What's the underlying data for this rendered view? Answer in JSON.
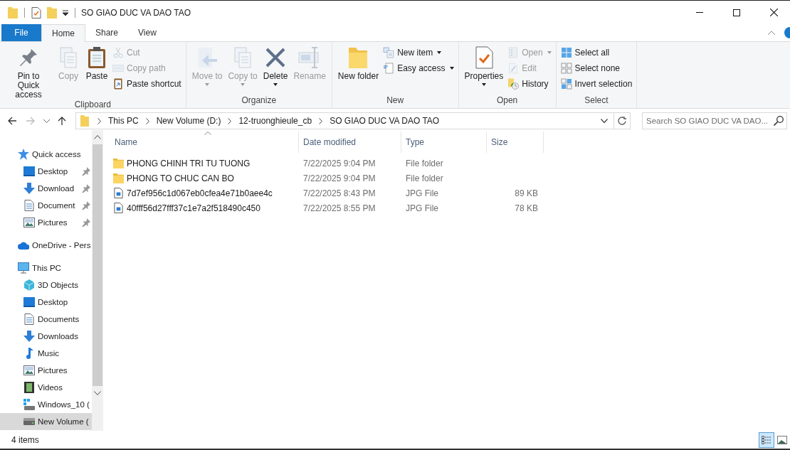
{
  "window": {
    "title": "SO GIAO DUC VA DAO TAO"
  },
  "tabs": [
    {
      "label": "File",
      "kind": "file",
      "selected": false
    },
    {
      "label": "Home",
      "kind": "tab",
      "selected": true
    },
    {
      "label": "Share",
      "kind": "tab",
      "selected": false
    },
    {
      "label": "View",
      "kind": "tab",
      "selected": false
    }
  ],
  "ribbon": [
    {
      "label": "Clipboard",
      "buttons": [
        {
          "kind": "pin",
          "label": "Pin to Quick access",
          "disabled": false,
          "dropdown": false
        },
        {
          "kind": "copy",
          "label": "Copy",
          "disabled": true,
          "dropdown": false
        },
        {
          "kind": "paste",
          "label": "Paste",
          "disabled": false,
          "dropdown": false
        }
      ],
      "small_buttons": [
        {
          "kind": "cut",
          "label": "Cut",
          "disabled": true,
          "dropdown": false
        },
        {
          "kind": "path",
          "label": "Copy path",
          "disabled": true,
          "dropdown": false
        },
        {
          "kind": "shortcut",
          "label": "Paste shortcut",
          "disabled": false,
          "dropdown": false
        }
      ]
    },
    {
      "label": "Organize",
      "buttons": [
        {
          "kind": "move",
          "label": "Move to",
          "disabled": true,
          "dropdown": true
        },
        {
          "kind": "copyto",
          "label": "Copy to",
          "disabled": true,
          "dropdown": true
        },
        {
          "kind": "delete",
          "label": "Delete",
          "disabled": false,
          "dropdown": true
        },
        {
          "kind": "rename",
          "label": "Rename",
          "disabled": true,
          "dropdown": false
        }
      ]
    },
    {
      "label": "New",
      "buttons": [
        {
          "kind": "folder",
          "label": "New folder",
          "disabled": false,
          "dropdown": false
        }
      ],
      "small_buttons": [
        {
          "kind": "newitem",
          "label": "New item",
          "disabled": false,
          "dropdown": true
        },
        {
          "kind": "easy",
          "label": "Easy access",
          "disabled": false,
          "dropdown": true
        }
      ]
    },
    {
      "label": "Open",
      "buttons": [
        {
          "kind": "properties",
          "label": "Properties",
          "disabled": false,
          "dropdown": true
        }
      ],
      "small_buttons": [
        {
          "kind": "open",
          "label": "Open",
          "disabled": true,
          "dropdown": true
        },
        {
          "kind": "edit",
          "label": "Edit",
          "disabled": true,
          "dropdown": false
        },
        {
          "kind": "history",
          "label": "History",
          "disabled": false,
          "dropdown": false
        }
      ]
    },
    {
      "label": "Select",
      "small_buttons": [
        {
          "kind": "selall",
          "label": "Select all",
          "disabled": false,
          "dropdown": false
        },
        {
          "kind": "selnone",
          "label": "Select none",
          "disabled": false,
          "dropdown": false
        },
        {
          "kind": "invert",
          "label": "Invert selection",
          "disabled": false,
          "dropdown": false
        }
      ]
    }
  ],
  "address": {
    "back_disabled": false,
    "forward_disabled": true,
    "path": [
      "This PC",
      "New Volume (D:)",
      "12-truonghieule_cb",
      "SO GIAO DUC VA DAO TAO"
    ],
    "search_placeholder": "Search SO GIAO DUC VA DAO..."
  },
  "sidebar": {
    "items": [
      {
        "kind": "star",
        "label": "Quick access",
        "selected": false,
        "children": [
          {
            "kind": "desktop",
            "label": "Desktop",
            "pinned": true,
            "selected": false
          },
          {
            "kind": "download",
            "label": "Download",
            "pinned": true,
            "selected": false
          },
          {
            "kind": "document",
            "label": "Document",
            "pinned": true,
            "selected": false
          },
          {
            "kind": "pictures",
            "label": "Pictures",
            "pinned": true,
            "selected": false
          }
        ]
      },
      {
        "kind": "cloud",
        "label": "OneDrive - Pers",
        "selected": false
      },
      {
        "kind": "pc",
        "label": "This PC",
        "selected": false,
        "children": [
          {
            "kind": "cube",
            "label": "3D Objects",
            "selected": false
          },
          {
            "kind": "desktop",
            "label": "Desktop",
            "selected": false
          },
          {
            "kind": "document",
            "label": "Documents",
            "selected": false
          },
          {
            "kind": "download",
            "label": "Downloads",
            "selected": false
          },
          {
            "kind": "music",
            "label": "Music",
            "selected": false
          },
          {
            "kind": "pictures",
            "label": "Pictures",
            "selected": false
          },
          {
            "kind": "video",
            "label": "Videos",
            "selected": false
          },
          {
            "kind": "windrive",
            "label": "Windows_10 (",
            "selected": false
          },
          {
            "kind": "drive",
            "label": "New Volume (",
            "selected": true
          }
        ]
      }
    ]
  },
  "table": {
    "columns": [
      {
        "label": "Name",
        "sorted": true
      },
      {
        "label": "Date modified",
        "sorted": false
      },
      {
        "label": "Type",
        "sorted": false
      },
      {
        "label": "Size",
        "sorted": false
      }
    ],
    "rows": [
      {
        "kind": "folder",
        "name": "PHONG CHINH TRI TU TUONG",
        "date": "7/22/2025 9:04 PM",
        "type": "File folder"
      },
      {
        "kind": "folder",
        "name": "PHONG TO CHUC CAN BO",
        "date": "7/22/2025 9:04 PM",
        "type": "File folder"
      },
      {
        "kind": "image",
        "name": "7d7ef956c1d067eb0cfea4e71b0aee4c",
        "date": "7/22/2025 8:43 PM",
        "type": "JPG File",
        "size": "89 KB"
      },
      {
        "kind": "image",
        "name": "40fff56d27fff37c1e7a2f518490c450",
        "date": "7/22/2025 8:55 PM",
        "type": "JPG File",
        "size": "78 KB"
      }
    ]
  },
  "status_bar": {
    "count": "4 items",
    "views": [
      {
        "kind": "details",
        "selected": true
      },
      {
        "kind": "large",
        "selected": false
      }
    ]
  }
}
